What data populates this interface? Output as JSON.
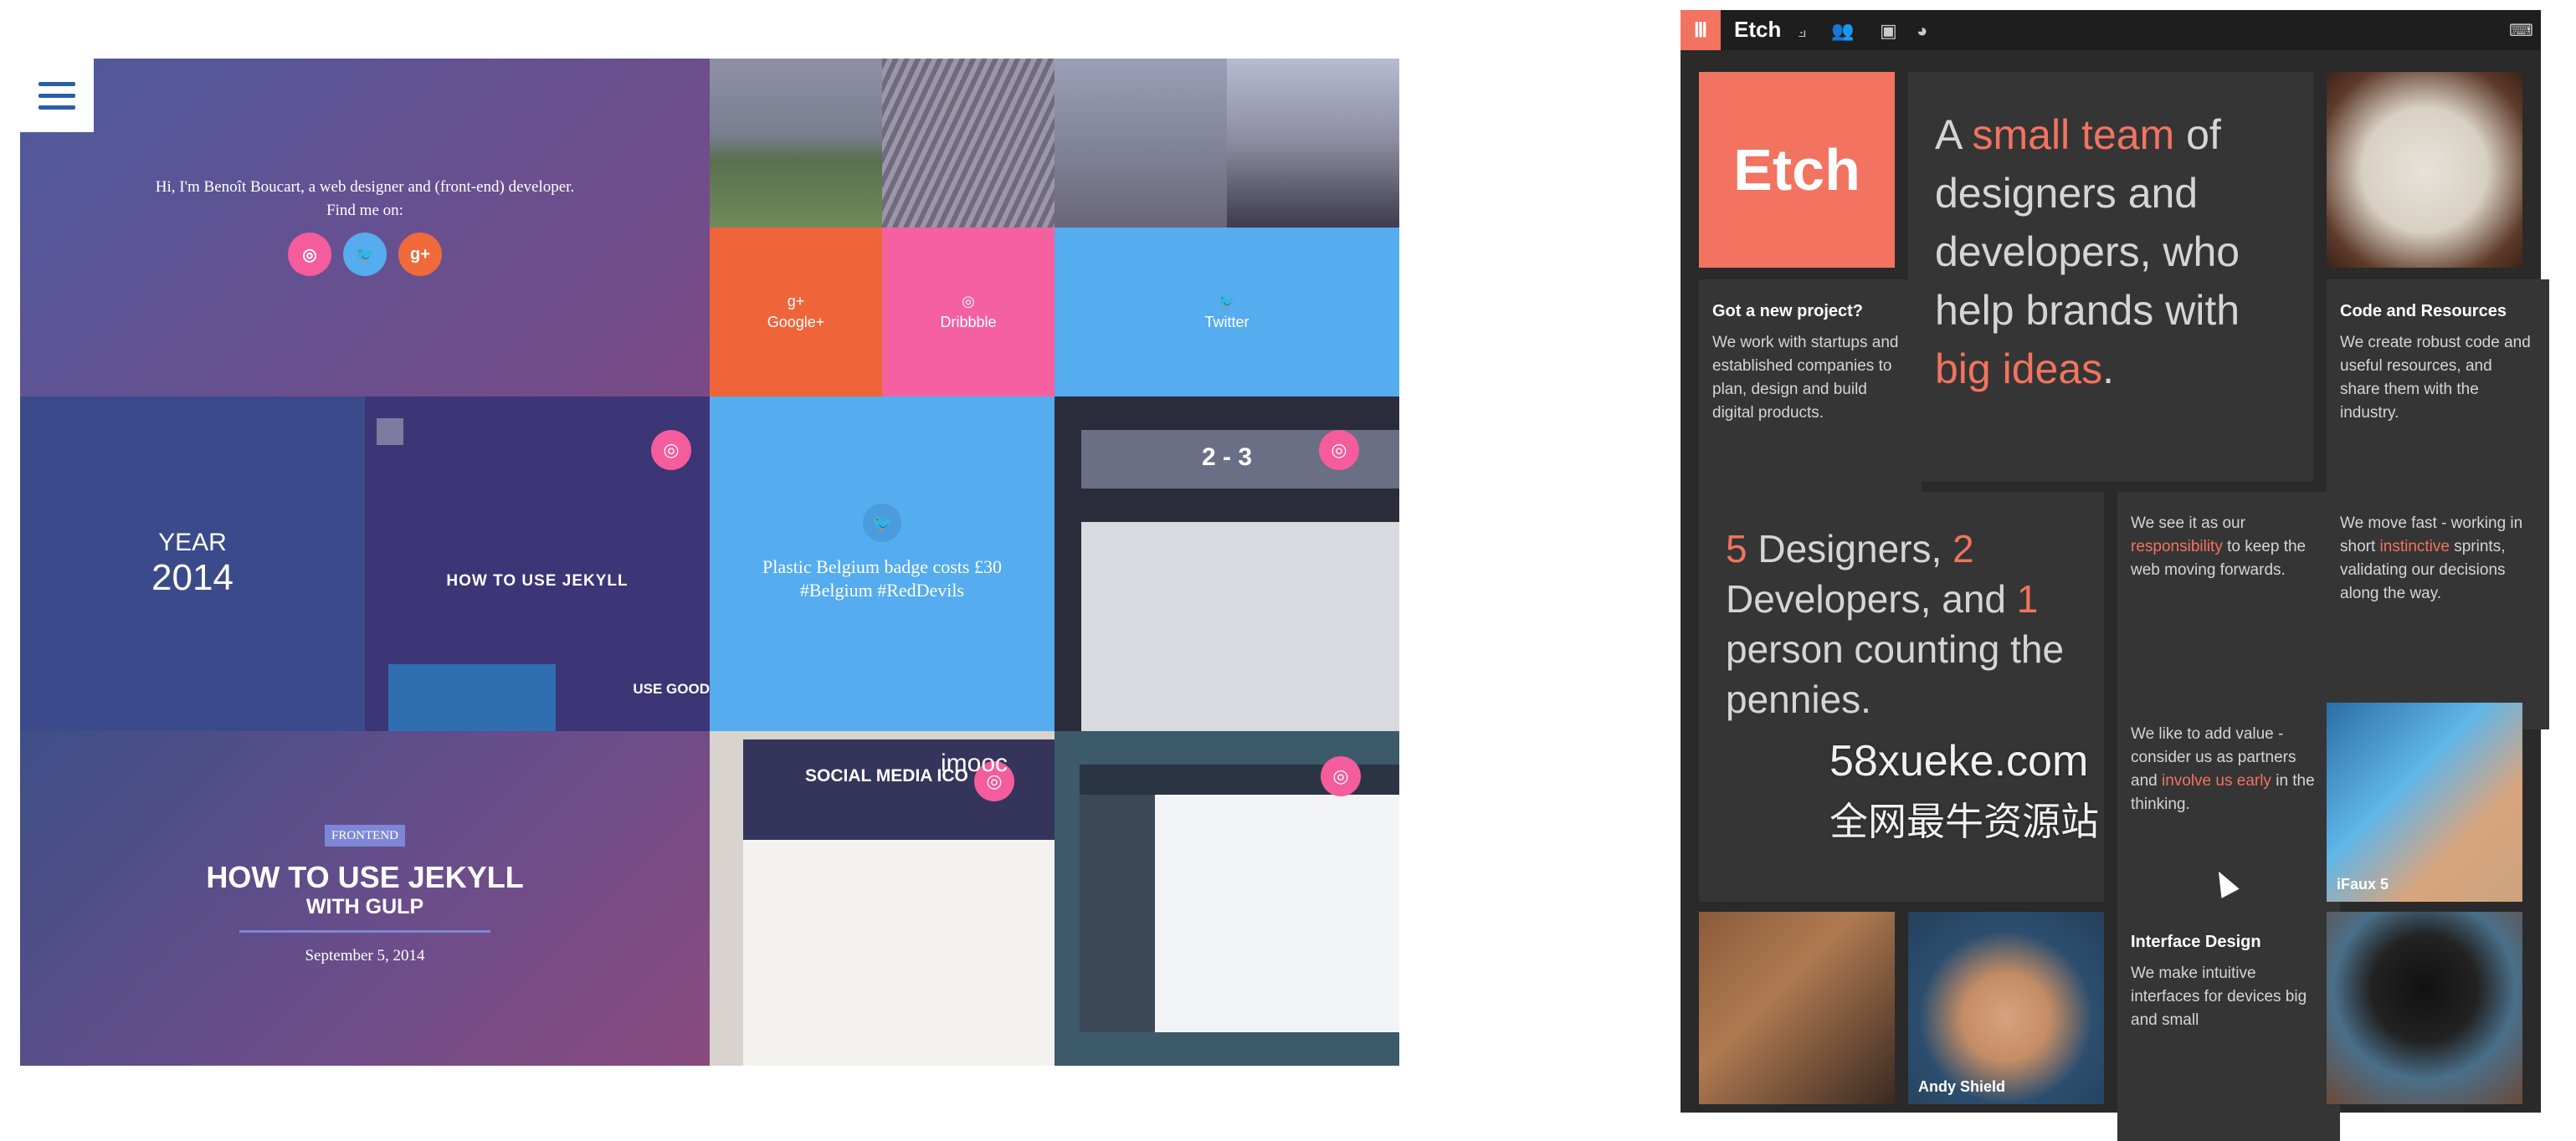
{
  "left_site": {
    "intro": {
      "line1": "Hi, I'm Benoît Boucart, a web designer and (front-end) developer.",
      "line2": "Find me on:"
    },
    "social_dots": [
      {
        "icon": "dribbble-icon",
        "glyph": "◎",
        "color": "#f55c9c"
      },
      {
        "icon": "twitter-icon",
        "glyph": "🐦",
        "color": "#55acee"
      },
      {
        "icon": "google-plus-icon",
        "glyph": "g+",
        "color": "#f06a3c"
      }
    ],
    "social_tiles": [
      {
        "glyph": "g+",
        "label": "Google+",
        "color": "#f0643a"
      },
      {
        "glyph": "◎",
        "label": "Dribbble",
        "color": "#f561a0"
      },
      {
        "glyph": "🐦",
        "label": "Twitter",
        "color": "#55acee"
      }
    ],
    "year": {
      "label": "YEAR",
      "value": "2014"
    },
    "jekyll_preview": {
      "title": "HOW TO USE JEKYLL",
      "side_text": "USE GOOD"
    },
    "tweet": {
      "text": "Plastic Belgium badge costs £30 #Belgium #RedDevils"
    },
    "score": {
      "text": "2 - 3"
    },
    "post": {
      "tag": "FRONTEND",
      "title": "HOW TO USE JEKYLL",
      "subtitle": "WITH GULP",
      "date": "September 5, 2014"
    },
    "social_media_post": {
      "title": "SOCIAL MEDIA ICO",
      "overlay": "imooc"
    },
    "badge_glyph": "◎",
    "menu_icon": "hamburger-icon"
  },
  "etch": {
    "menu_glyph": "Ⅲ",
    "logo_small": "Etch",
    "logo_big": "Etch",
    "nav_icons": [
      {
        "name": "chair-icon",
        "glyph": "⟓"
      },
      {
        "name": "team-icon",
        "glyph": "👥"
      },
      {
        "name": "presentation-icon",
        "glyph": "▣"
      },
      {
        "name": "head-icon",
        "glyph": "◕"
      }
    ],
    "right_icon": "keyboard-icon",
    "hero": {
      "a": "A ",
      "hl1": "small team",
      "b": " of designers and developers, who help brands with ",
      "hl2": "big ideas",
      "c": "."
    },
    "cards": {
      "new_project": {
        "title": "Got a new project?",
        "text": "We work with startups and established companies to plan, design and build digital products."
      },
      "code": {
        "title": "Code and Resources",
        "text": "We create robust code and useful resources, and share them with the industry."
      },
      "responsibility": {
        "a": "We see it as our ",
        "hl": "responsibility",
        "b": " to keep the web moving forwards."
      },
      "fast": {
        "a": "We move fast - working in short ",
        "hl": "instinctive",
        "b": " sprints, validating our decisions along the way."
      },
      "value": {
        "a": "We like to add value - consider us as partners and ",
        "hl": "involve us early",
        "b": " in the thinking."
      },
      "interface": {
        "title": "Interface Design",
        "text": "We make intuitive interfaces for devices big and small"
      }
    },
    "stats": {
      "n1": "5",
      "t1": " Designers, ",
      "n2": "2",
      "t2": " Developers, and ",
      "n3": "1",
      "t3": " person counting the pennies."
    },
    "captions": {
      "ifaux": "iFaux 5",
      "andy": "Andy Shield"
    },
    "accent_color": "#f2735f"
  },
  "watermark": {
    "line1": "58xueke.com",
    "line2": "全网最牛资源站"
  }
}
